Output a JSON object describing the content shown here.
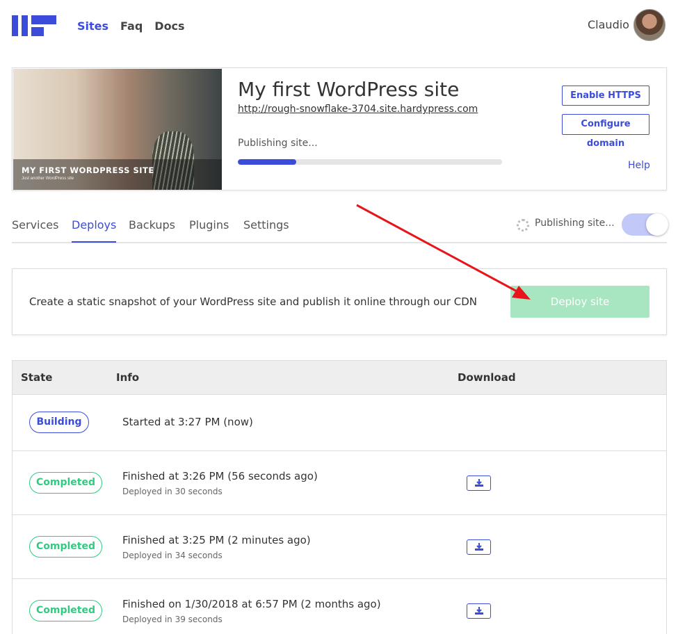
{
  "header": {
    "nav": [
      {
        "label": "Sites",
        "active": true
      },
      {
        "label": "Faq",
        "active": false
      },
      {
        "label": "Docs",
        "active": false
      }
    ],
    "user_name": "Claudio",
    "brand_color": "#3b4cdb"
  },
  "site": {
    "thumbnail_title": "MY FIRST WORDPRESS SITE",
    "thumbnail_subtitle": "Just another WordPress site",
    "title": "My first WordPress site",
    "url": "http://rough-snowflake-3704.site.hardypress.com",
    "status": "Publishing site...",
    "progress": 0.22,
    "buttons": {
      "https": "Enable HTTPS",
      "domain": "Configure domain"
    },
    "help": "Help"
  },
  "tabs": [
    {
      "label": "Services",
      "active": false
    },
    {
      "label": "Deploys",
      "active": true
    },
    {
      "label": "Backups",
      "active": false
    },
    {
      "label": "Plugins",
      "active": false
    },
    {
      "label": "Settings",
      "active": false
    }
  ],
  "tabs_status": "Publishing site...",
  "toggle_on": true,
  "deploy": {
    "description": "Create a static snapshot of your WordPress site and publish it online through our CDN",
    "button": "Deploy site",
    "button_color": "#a8e6c2"
  },
  "table": {
    "headers": {
      "state": "State",
      "info": "Info",
      "download": "Download"
    },
    "rows": [
      {
        "state": "Building",
        "main": "Started at 3:27 PM (now)",
        "sub": "",
        "download": false
      },
      {
        "state": "Completed",
        "main": "Finished at 3:26 PM (56 seconds ago)",
        "sub": "Deployed in 30 seconds",
        "download": true
      },
      {
        "state": "Completed",
        "main": "Finished at 3:25 PM (2 minutes ago)",
        "sub": "Deployed in 34 seconds",
        "download": true
      },
      {
        "state": "Completed",
        "main": "Finished on 1/30/2018 at 6:57 PM (2 months ago)",
        "sub": "Deployed in 39 seconds",
        "download": true
      }
    ]
  },
  "colors": {
    "building": "#3b4cdb",
    "completed": "#2ecc80",
    "arrow": "#e8141a"
  }
}
